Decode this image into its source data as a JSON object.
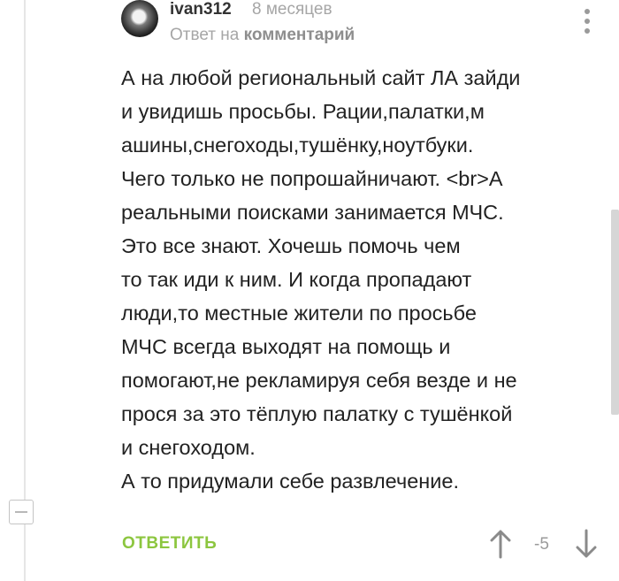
{
  "comment": {
    "username": "ivan312",
    "time": "8 месяцев",
    "reply_prefix": "Ответ на",
    "reply_target": "комментарий",
    "lines": [
      "А на любой региональный сайт ЛА зайди",
      "и увидишь просьбы. Рации,палатки,м",
      "ашины,снегоходы,тушёнку,ноутбуки.",
      "Чего только не попрошайничают. <br>А",
      "реальными поисками занимается МЧС.",
      "Это все знают. Хочешь помочь чем",
      "то так иди к ним. И когда пропадают",
      "люди,то местные жители по просьбе",
      "МЧС всегда выходят на помощь и",
      "помогают,не рекламируя себя везде и не",
      "прося за это тёплую палатку с тушёнкой",
      "и снегоходом.",
      "А то придумали себе развлечение."
    ]
  },
  "actions": {
    "reply_label": "ОТВЕТИТЬ",
    "rating": "-5"
  },
  "colors": {
    "reply_accent": "#8cc63f",
    "muted_text": "#a6a6a6",
    "icon_gray": "#8a8a8a"
  },
  "icons": [
    "avatar",
    "more-vertical-icon",
    "collapse-icon",
    "arrow-up-icon",
    "arrow-down-icon"
  ]
}
